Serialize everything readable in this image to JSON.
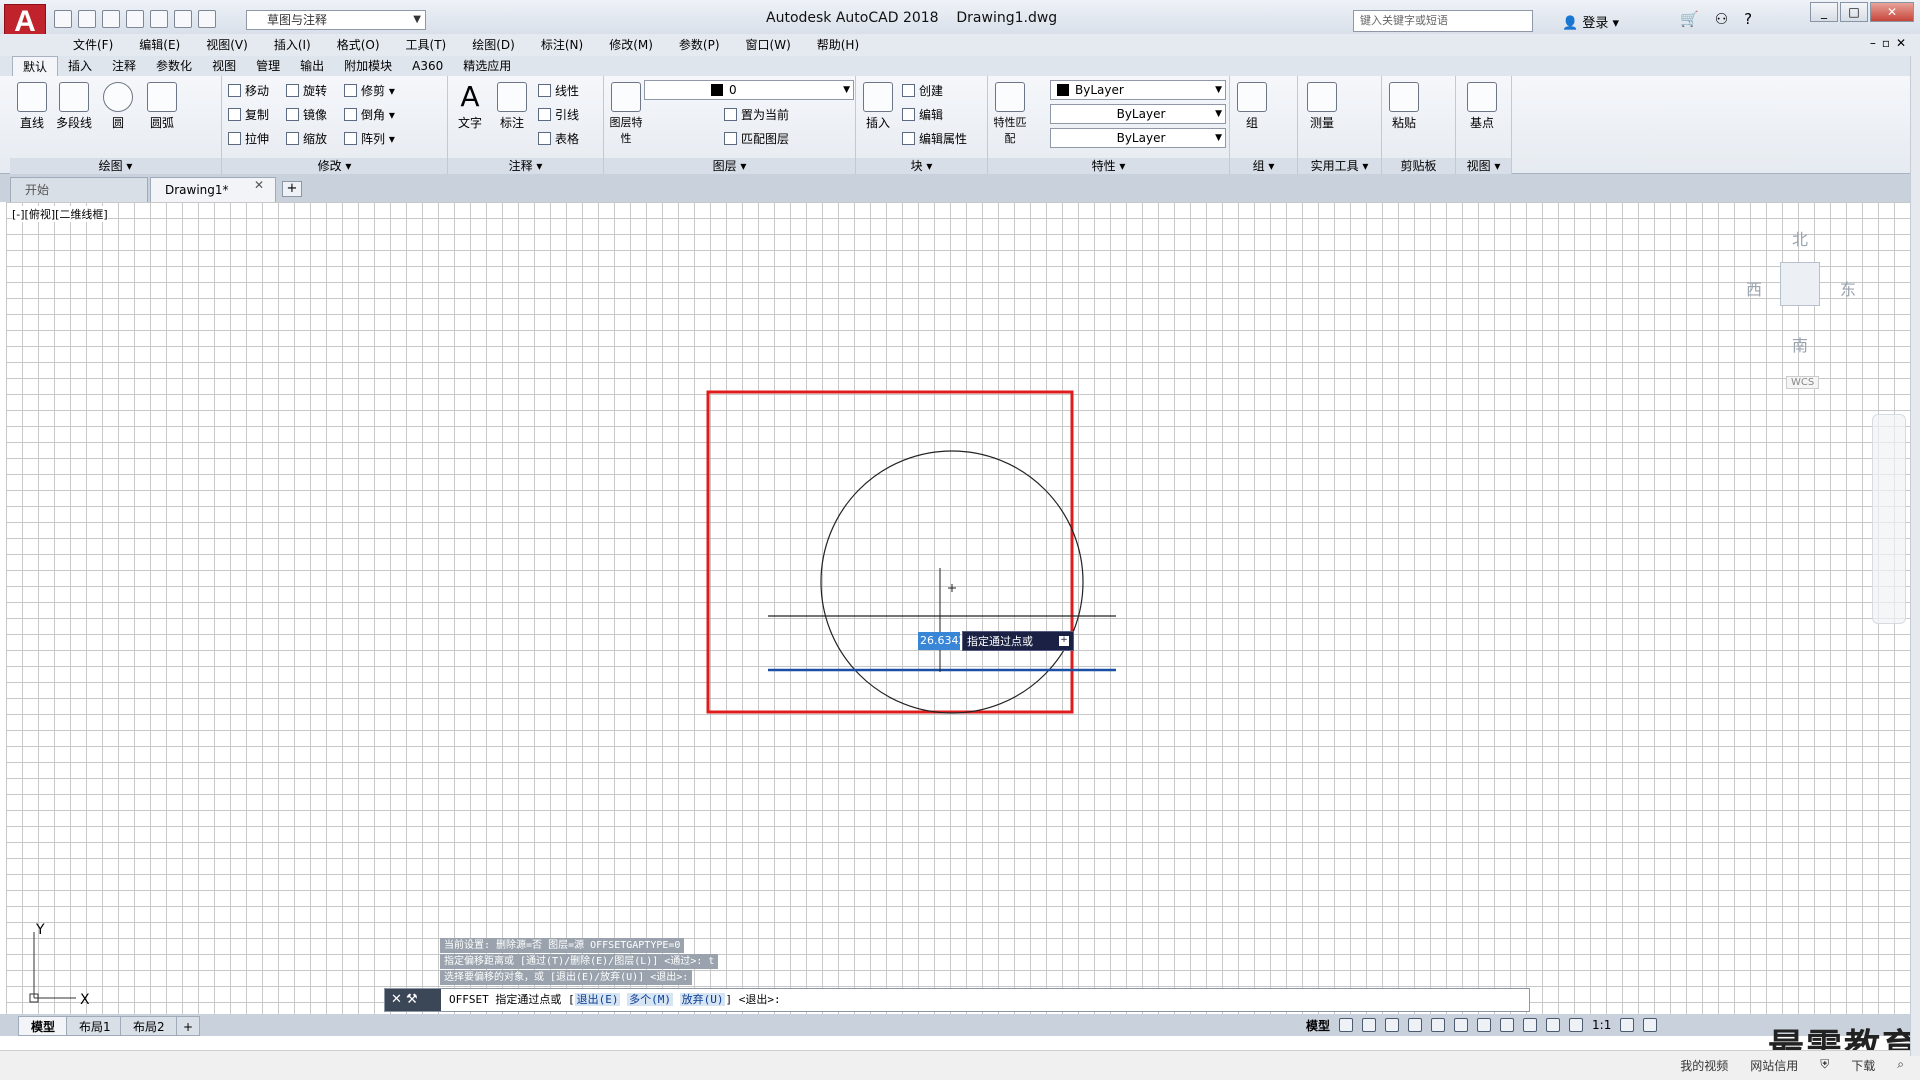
{
  "app": {
    "title": "Autodesk AutoCAD 2018",
    "document": "Drawing1.dwg",
    "logo": "A"
  },
  "workspace": "草图与注释",
  "search": {
    "placeholder": "键入关键字或短语"
  },
  "login": "登录",
  "menubar": [
    "文件(F)",
    "编辑(E)",
    "视图(V)",
    "插入(I)",
    "格式(O)",
    "工具(T)",
    "绘图(D)",
    "标注(N)",
    "修改(M)",
    "参数(P)",
    "窗口(W)",
    "帮助(H)"
  ],
  "ribbon_tabs": [
    "默认",
    "插入",
    "注释",
    "参数化",
    "视图",
    "管理",
    "输出",
    "附加模块",
    "A360",
    "精选应用"
  ],
  "ribbon": {
    "draw": {
      "title": "绘图",
      "line": "直线",
      "polyline": "多段线",
      "circle": "圆",
      "arc": "圆弧"
    },
    "modify": {
      "title": "修改",
      "move": "移动",
      "rotate": "旋转",
      "trim": "修剪",
      "copy": "复制",
      "mirror": "镜像",
      "chamfer": "倒角",
      "stretch": "拉伸",
      "scale": "缩放",
      "array": "阵列"
    },
    "annotation": {
      "title": "注释",
      "text": "文字",
      "dimension": "标注",
      "linear": "线性",
      "leader": "引线",
      "table": "表格"
    },
    "layers": {
      "title": "图层",
      "props": "图层特性",
      "layer_value": "0",
      "set_current": "置为当前",
      "match_layer": "匹配图层"
    },
    "block": {
      "title": "块",
      "insert": "插入",
      "create": "创建",
      "edit": "编辑",
      "edit_attr": "编辑属性"
    },
    "properties": {
      "title": "特性",
      "match": "特性匹配",
      "color": "ByLayer",
      "linetype": "ByLayer",
      "lineweight": "ByLayer"
    },
    "groups": {
      "title": "组",
      "group": "组"
    },
    "utilities": {
      "title": "实用工具",
      "measure": "测量"
    },
    "clipboard": {
      "title": "剪贴板",
      "paste": "粘贴"
    },
    "view": {
      "title": "视图",
      "base": "基点"
    }
  },
  "file_tabs": {
    "start": "开始",
    "drawing": "Drawing1*"
  },
  "viewport_label": "[-][俯视][二维线框]",
  "viewcube": {
    "north": "北",
    "south": "南",
    "east": "东",
    "west": "西",
    "wcs": "WCS"
  },
  "dynamic_input": {
    "value": "26.6342",
    "prompt": "指定通过点或"
  },
  "ucs": {
    "x": "X",
    "y": "Y"
  },
  "command_history": [
    "当前设置: 删除源=否  图层=源  OFFSETGAPTYPE=0",
    "指定偏移距离或 [通过(T)/删除(E)/图层(L)] <通过>: t",
    "选择要偏移的对象，或 [退出(E)/放弃(U)] <退出>:"
  ],
  "command_line": {
    "prefix": "OFFSET 指定通过点或 [",
    "opt1": "退出(E)",
    "opt2": "多个(M)",
    "opt3": "放弃(U)",
    "suffix": "] <退出>:"
  },
  "layout_tabs": [
    "模型",
    "布局1",
    "布局2"
  ],
  "status": {
    "model": "模型",
    "scale": "1:1"
  },
  "bottom_links": [
    "我的视频",
    "网站信用",
    "下载"
  ],
  "watermark": "最需教育"
}
